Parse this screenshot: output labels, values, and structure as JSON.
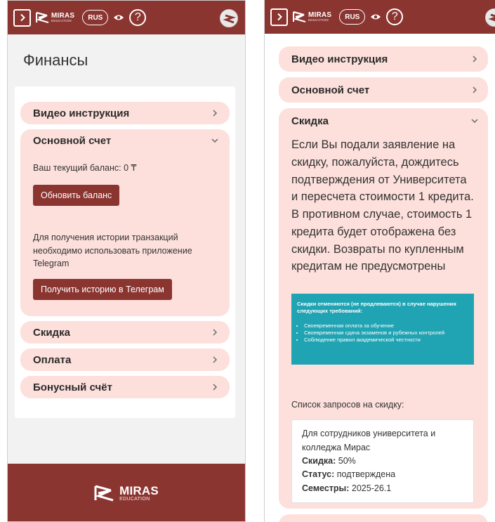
{
  "header": {
    "logo_main": "MIRAS",
    "logo_sub": "EDUCATION",
    "language": "RUS",
    "help": "?"
  },
  "left": {
    "page_title": "Финансы",
    "accordion": [
      {
        "title": "Видео инструкция"
      },
      {
        "title": "Основной счет",
        "balance_text": "Ваш текущий баланс: 0 ₸",
        "refresh_button": "Обновить баланс",
        "history_text": "Для получения истории транзакций необходимо использовать приложение Telegram",
        "telegram_button": "Получить историю в Телеграм"
      },
      {
        "title": "Скидка"
      },
      {
        "title": "Оплата"
      },
      {
        "title": "Бонусный счёт"
      }
    ],
    "footer": {
      "logo_main": "MIRAS",
      "logo_sub": "EDUCATION"
    }
  },
  "right": {
    "accordion": [
      {
        "title": "Видео инструкция"
      },
      {
        "title": "Основной счет"
      },
      {
        "title": "Скидка"
      }
    ],
    "discount_text": "Если Вы подали заявление на скидку, пожалуйста, дождитесь подтверждения от Университета и пересчета стоимости 1 кредита. В противном случае, стоимость 1 кредита будет отображена без скидки. Возвраты по купленным кредитам не предусмотрены",
    "info_box": {
      "heading": "Скидки отменяются (не продлеваются) в случае нарушения следующих требований:",
      "items": [
        "Своевременная оплата за обучение",
        "Своевременная сдача экзаменов и рубежных контролей",
        "Соблюдение правил академической честности"
      ]
    },
    "requests_label": "Список запросов на скидку:",
    "request": {
      "title": "Для сотрудников университета и колледжа Мирас",
      "discount_label": "Скидка:",
      "discount_value": "50%",
      "status_label": "Статус:",
      "status_value": "подтверждена",
      "semesters_label": "Семестры:",
      "semesters_value": "2025-26.1"
    }
  },
  "colors": {
    "brand": "#8b3531",
    "accordion_bg": "#fde0dc",
    "info_box": "#20a3b2"
  }
}
